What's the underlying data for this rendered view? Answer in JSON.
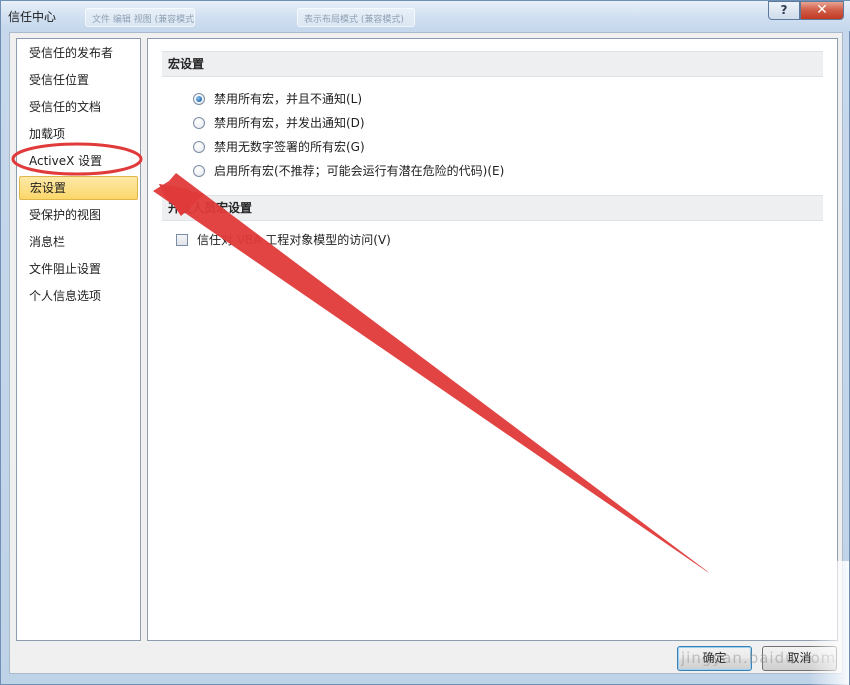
{
  "window": {
    "title": "信任中心",
    "ghost_tab_1": "文件 编辑 视图 (兼容模式)",
    "ghost_tab_2": "表示布局模式 (兼容模式)",
    "help_label": "?",
    "close_label": "✕"
  },
  "sidebar": {
    "items": [
      {
        "label": "受信任的发布者"
      },
      {
        "label": "受信任位置"
      },
      {
        "label": "受信任的文档"
      },
      {
        "label": "加载项"
      },
      {
        "label": "ActiveX 设置"
      },
      {
        "label": "宏设置"
      },
      {
        "label": "受保护的视图"
      },
      {
        "label": "消息栏"
      },
      {
        "label": "文件阻止设置"
      },
      {
        "label": "个人信息选项"
      }
    ],
    "selected": "宏设置"
  },
  "macro_settings": {
    "header": "宏设置",
    "options": [
      {
        "label": "禁用所有宏，并且不通知(L)",
        "selected": true
      },
      {
        "label": "禁用所有宏，并发出通知(D)",
        "selected": false
      },
      {
        "label": "禁用无数字签署的所有宏(G)",
        "selected": false
      },
      {
        "label": "启用所有宏(不推荐；可能会运行有潜在危险的代码)(E)",
        "selected": false
      }
    ]
  },
  "developer_settings": {
    "header": "开发人员宏设置",
    "trust_vba_label": "信任对 VBA 工程对象模型的访问(V)",
    "trust_vba_checked": false
  },
  "buttons": {
    "ok": "确定",
    "cancel": "取消"
  },
  "watermark": "jingyan.baidu.com",
  "colors": {
    "annotation_red": "#e03a3a",
    "selection_yellow": "#fbd76a"
  }
}
